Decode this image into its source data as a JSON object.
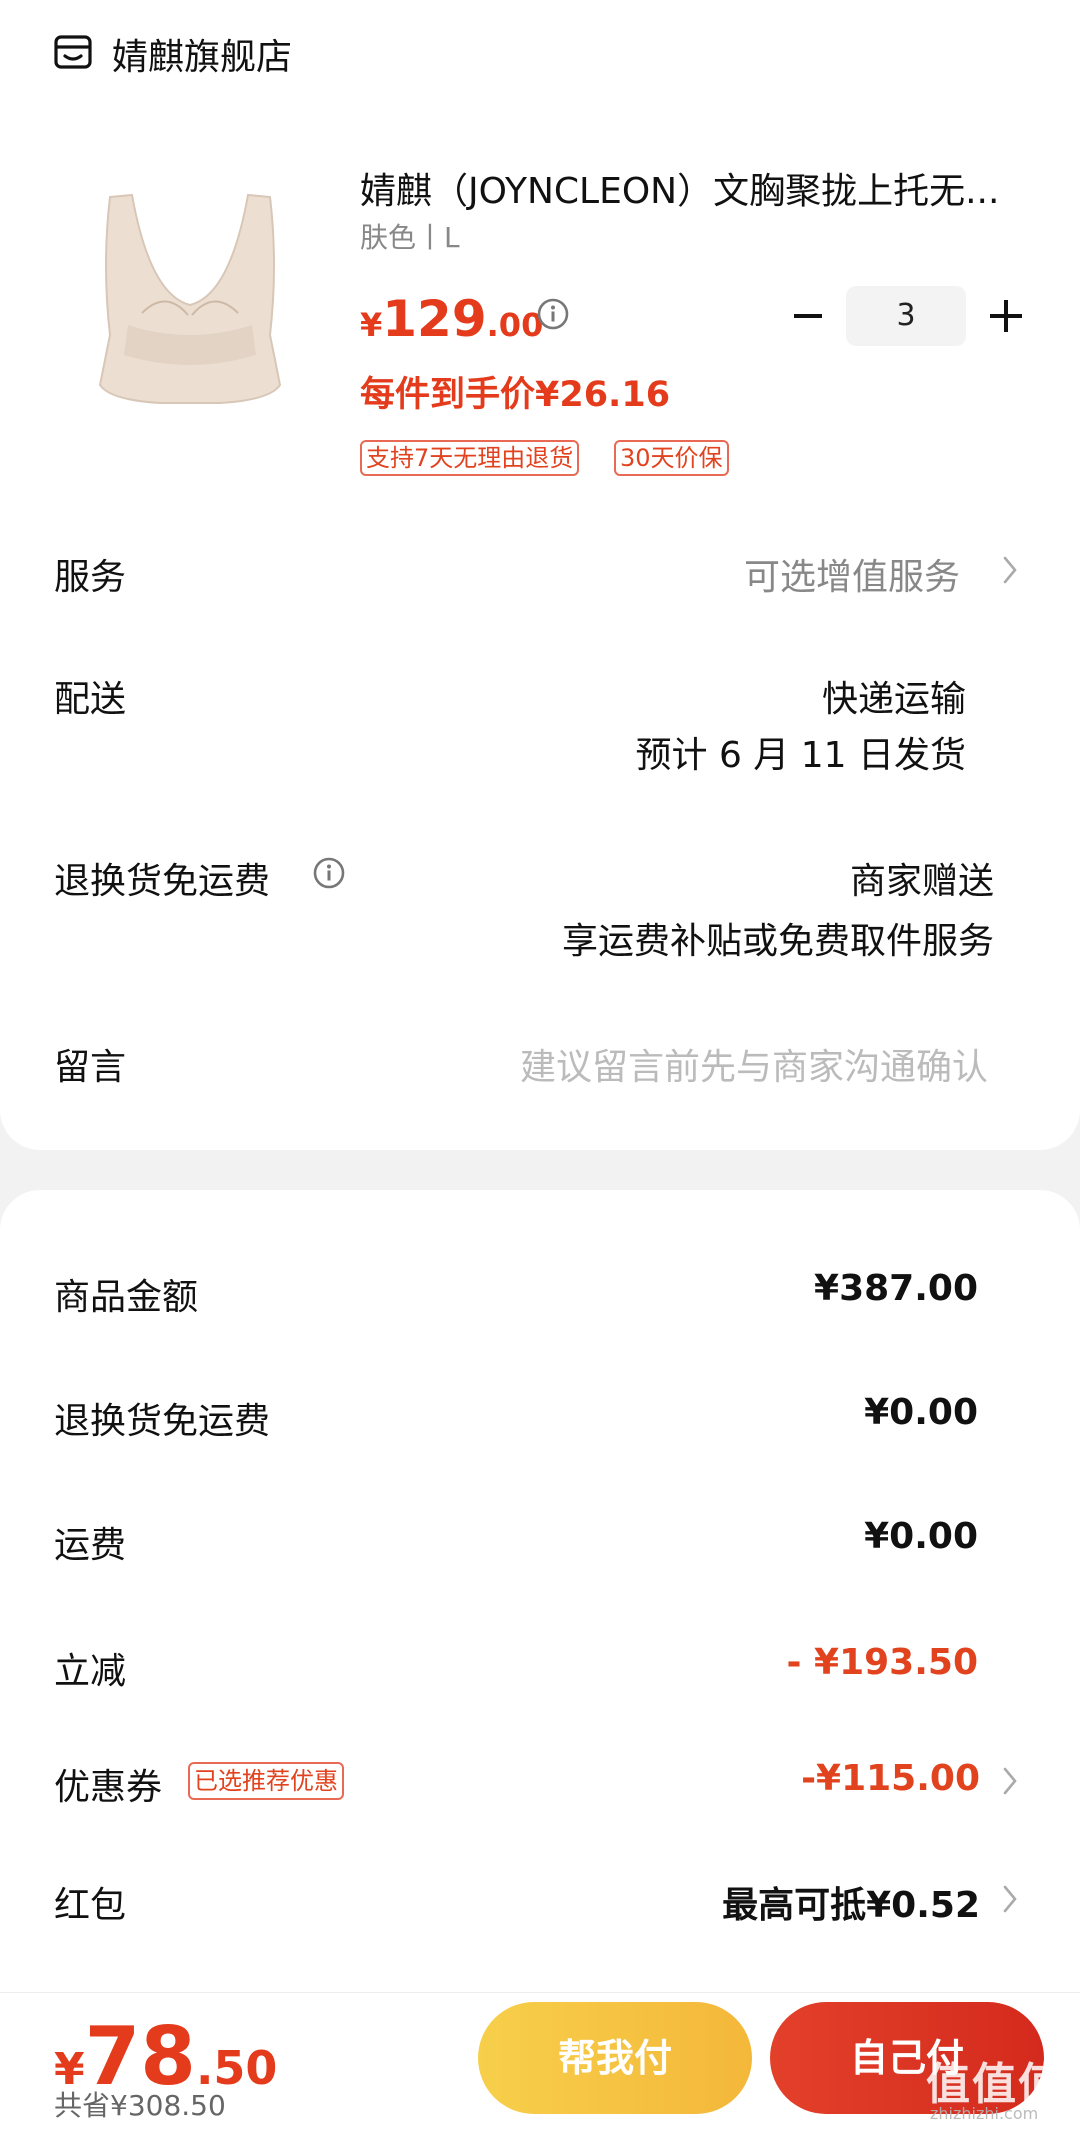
{
  "store": {
    "name": "婧麒旗舰店",
    "icon": "store-icon"
  },
  "product": {
    "title": "婧麒（JOYNCLEON）文胸聚拢上托无...",
    "spec": "肤色丨L",
    "price_symbol": "¥",
    "price_int": "129",
    "price_dec": ".00",
    "unit_price": "每件到手价¥26.16",
    "quantity": "3",
    "tags": [
      "支持7天无理由退货",
      "30天价保"
    ]
  },
  "rows": {
    "service_label": "服务",
    "service_value": "可选增值服务",
    "delivery_label": "配送",
    "delivery_line1": "快递运输",
    "delivery_line2": "预计 6 月 11 日发货",
    "return_label": "退换货免运费",
    "return_line1": "商家赠送",
    "return_line2": "享运费补贴或免费取件服务",
    "message_label": "留言",
    "message_placeholder": "建议留言前先与商家沟通确认"
  },
  "summary": {
    "goods_label": "商品金额",
    "goods_value": "¥387.00",
    "return_fee_label": "退换货免运费",
    "return_fee_value": "¥0.00",
    "shipping_label": "运费",
    "shipping_value": "¥0.00",
    "discount_label": "立减",
    "discount_value": "- ¥193.50",
    "coupon_label": "优惠券",
    "coupon_tag": "已选推荐优惠",
    "coupon_value": "-¥115.00",
    "redpacket_label": "红包",
    "redpacket_value": "最高可抵¥0.52"
  },
  "footer": {
    "total_symbol": "¥",
    "total_int": "78",
    "total_dec": ".50",
    "saved": "共省¥308.50",
    "help_pay": "帮我付",
    "self_pay": "自己付",
    "watermark": "值值值",
    "watermark_url": "zhizhizhi.com"
  },
  "colors": {
    "accent": "#e33b1b",
    "yellow_btn": "#f6c343",
    "red_btn": "#dc3321"
  }
}
